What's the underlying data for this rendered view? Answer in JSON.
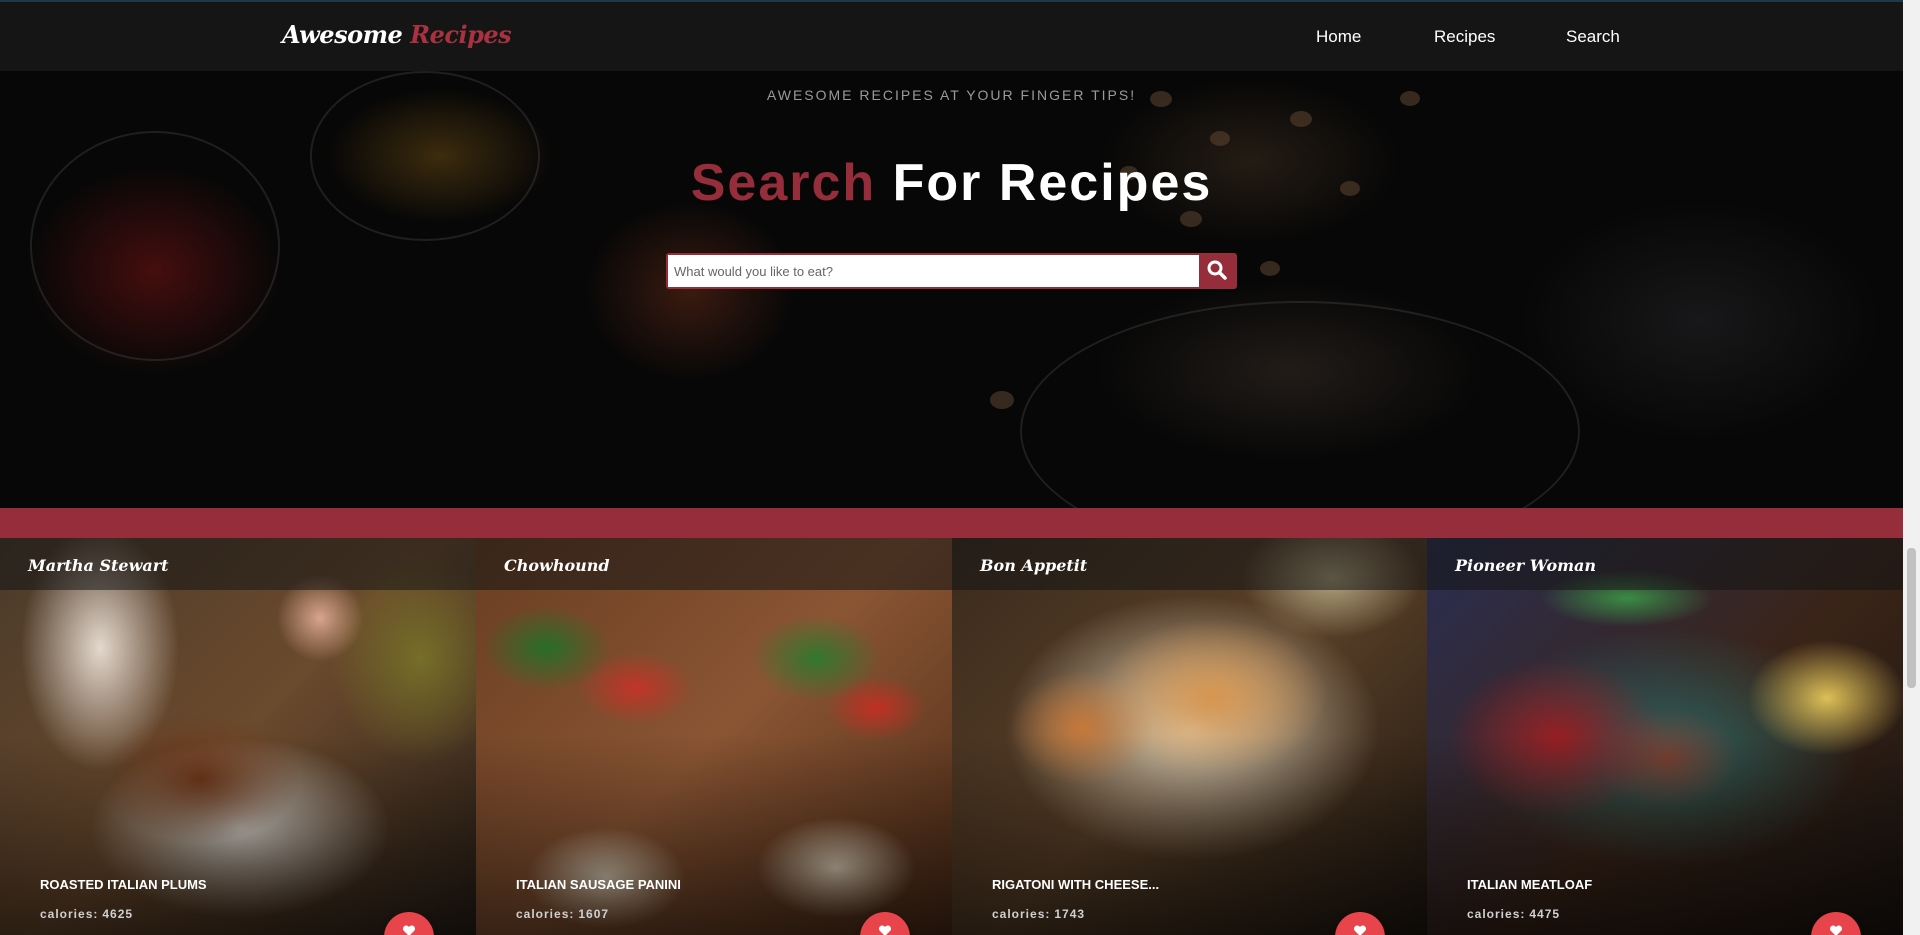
{
  "brand": {
    "part1": "Awesome",
    "part2": "Recipes"
  },
  "nav": {
    "home": "Home",
    "recipes": "Recipes",
    "search": "Search"
  },
  "hero": {
    "tagline": "AWESOME RECIPES AT YOUR FINGER TIPS!",
    "title_highlight": "Search",
    "title_rest": "For Recipes",
    "search_placeholder": "What would you like to eat?",
    "search_icon": "magnifier-icon"
  },
  "cards": [
    {
      "source": "Martha Stewart",
      "title": "ROASTED ITALIAN PLUMS",
      "calories_label": "calories:",
      "calories": "4625"
    },
    {
      "source": "Chowhound",
      "title": "ITALIAN SAUSAGE PANINI",
      "calories_label": "calories:",
      "calories": "1607"
    },
    {
      "source": "Bon Appetit",
      "title": "RIGATONI WITH CHEESE...",
      "calories_label": "calories:",
      "calories": "1743"
    },
    {
      "source": "Pioneer Woman",
      "title": "ITALIAN MEATLOAF",
      "calories_label": "calories:",
      "calories": "4475"
    }
  ],
  "colors": {
    "accent": "#952e3a",
    "brand_red": "#a8323f",
    "navbar": "#151515",
    "fab": "#e8444c"
  },
  "card_fab_icon": "heart-icon"
}
